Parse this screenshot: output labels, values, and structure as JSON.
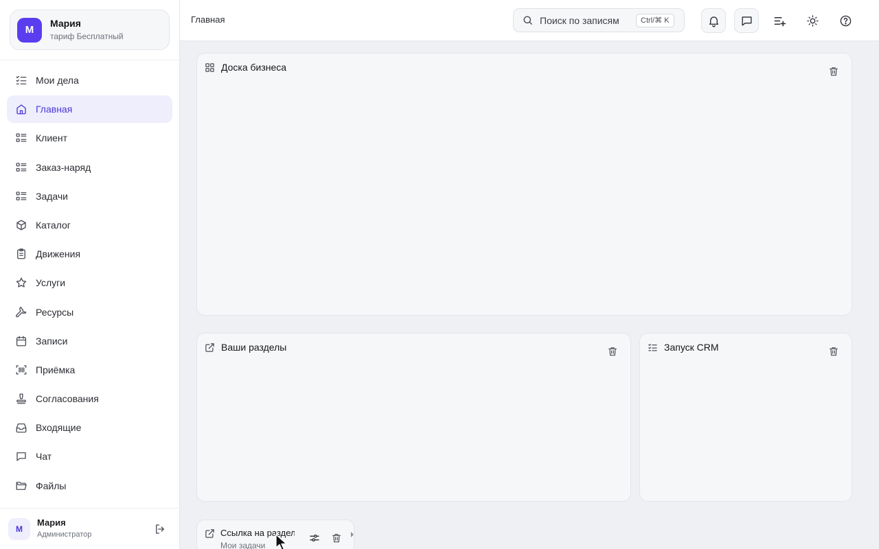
{
  "profile": {
    "initial": "М",
    "name": "Мария",
    "plan": "тариф Бесплатный"
  },
  "nav": {
    "items": [
      {
        "label": "Мои дела",
        "icon": "checklist-icon"
      },
      {
        "label": "Главная",
        "icon": "home-icon",
        "active": true
      },
      {
        "label": "Клиент",
        "icon": "list-icon"
      },
      {
        "label": "Заказ-наряд",
        "icon": "list-icon"
      },
      {
        "label": "Задачи",
        "icon": "list-icon"
      },
      {
        "label": "Каталог",
        "icon": "box-icon"
      },
      {
        "label": "Движения",
        "icon": "clipboard-icon"
      },
      {
        "label": "Услуги",
        "icon": "star-icon"
      },
      {
        "label": "Ресурсы",
        "icon": "wrench-icon"
      },
      {
        "label": "Записи",
        "icon": "calendar-icon"
      },
      {
        "label": "Приёмка",
        "icon": "barcode-scan-icon"
      },
      {
        "label": "Согласования",
        "icon": "stamp-icon"
      },
      {
        "label": "Входящие",
        "icon": "inbox-icon"
      },
      {
        "label": "Чат",
        "icon": "chat-icon"
      },
      {
        "label": "Файлы",
        "icon": "folder-icon"
      }
    ]
  },
  "user": {
    "initial": "М",
    "name": "Мария",
    "role": "Администратор"
  },
  "topbar": {
    "breadcrumb": "Главная",
    "search_placeholder": "Поиск по записям",
    "search_shortcut": "Ctrl/⌘ K"
  },
  "widgets": {
    "business_board": {
      "title": "Доска бизнеса"
    },
    "your_sections": {
      "title": "Ваши разделы"
    },
    "crm_launch": {
      "title": "Запуск CRM"
    },
    "section_link": {
      "title": "Ссылка на разделы",
      "subtitle": "Мои задачи"
    }
  },
  "colors": {
    "accent": "#5b3df0",
    "active_bg": "#eeeefd",
    "page_bg": "#eef0f4",
    "card_bg": "#f6f7f9"
  }
}
